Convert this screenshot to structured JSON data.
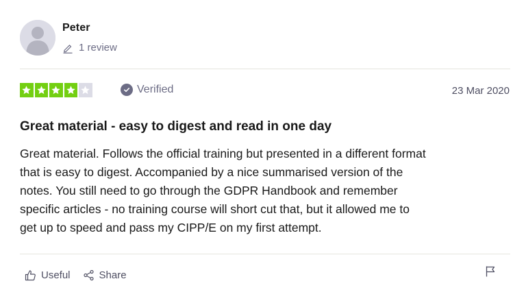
{
  "reviewer": {
    "name": "Peter",
    "review_count": "1 review",
    "avatar_icon": "user-silhouette-icon"
  },
  "rating": {
    "stars": 4,
    "max_stars": 5,
    "star_color": "#73cf11",
    "empty_star_color": "#dcdce6",
    "verified_label": "Verified"
  },
  "review": {
    "date": "23 Mar 2020",
    "title": "Great material - easy to digest and read in one day",
    "body_lines": [
      "Great material. Follows the official training but presented in a different format",
      "that is easy to digest. Accompanied by a nice summarised version of the",
      "notes. You still need to go through the GDPR Handbook and remember",
      "specific articles - no training course will short cut that, but it allowed me to",
      "get up to speed and pass my CIPP/E on my first attempt."
    ]
  },
  "actions": {
    "useful_label": "Useful",
    "share_label": "Share",
    "flag_icon": "flag-icon"
  }
}
